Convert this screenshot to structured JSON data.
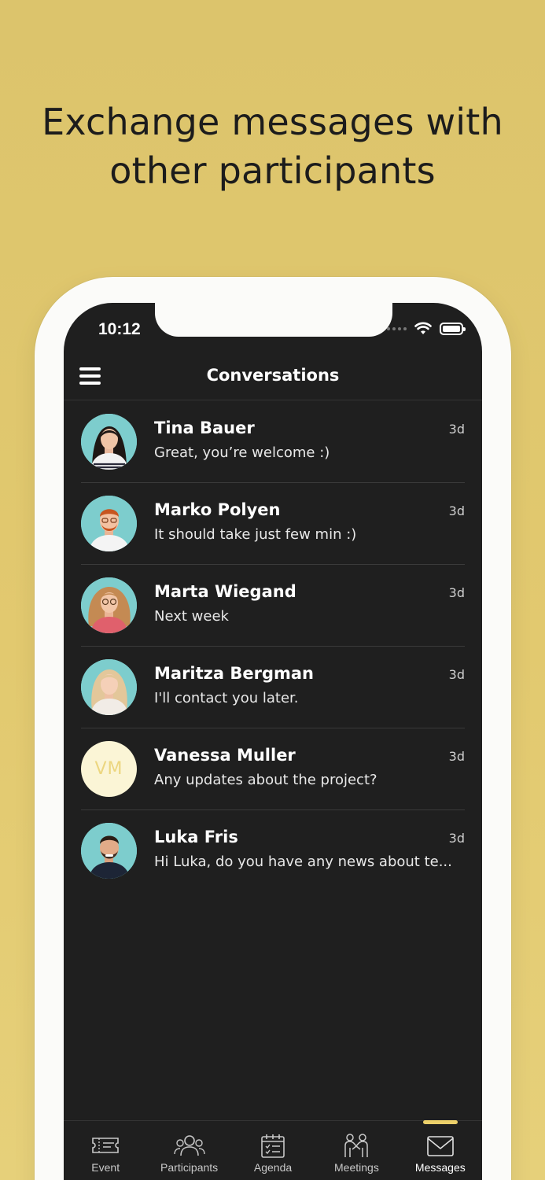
{
  "headline": {
    "line1": "Exchange messages with",
    "line2": "other participants"
  },
  "status_bar": {
    "time": "10:12"
  },
  "header": {
    "title": "Conversations",
    "menu_icon": "hamburger-menu-icon"
  },
  "conversations": [
    {
      "name": "Tina Bauer",
      "message": "Great, you’re welcome :)",
      "time": "3d",
      "avatar": "photo"
    },
    {
      "name": "Marko Polyen",
      "message": "It should take just few min :)",
      "time": "3d",
      "avatar": "photo"
    },
    {
      "name": "Marta Wiegand",
      "message": "Next week",
      "time": "3d",
      "avatar": "photo"
    },
    {
      "name": "Maritza Bergman",
      "message": "I'll contact you later.",
      "time": "3d",
      "avatar": "photo"
    },
    {
      "name": "Vanessa Muller",
      "message": "Any updates about the project?",
      "time": "3d",
      "avatar": "initials",
      "initials": "VM"
    },
    {
      "name": "Luka Fris",
      "message": "Hi Luka, do you have any news about te...",
      "time": "3d",
      "avatar": "photo"
    }
  ],
  "tabbar": {
    "tabs": [
      {
        "label": "Event",
        "icon": "ticket-icon"
      },
      {
        "label": "Participants",
        "icon": "participants-icon"
      },
      {
        "label": "Agenda",
        "icon": "calendar-icon"
      },
      {
        "label": "Meetings",
        "icon": "handshake-icon"
      },
      {
        "label": "Messages",
        "icon": "envelope-icon",
        "active": true
      }
    ]
  },
  "colors": {
    "background": "#e2c96f",
    "screen": "#1f1f1f",
    "accent": "#ecd06a",
    "initials_avatar_bg": "#fbf5d6"
  }
}
